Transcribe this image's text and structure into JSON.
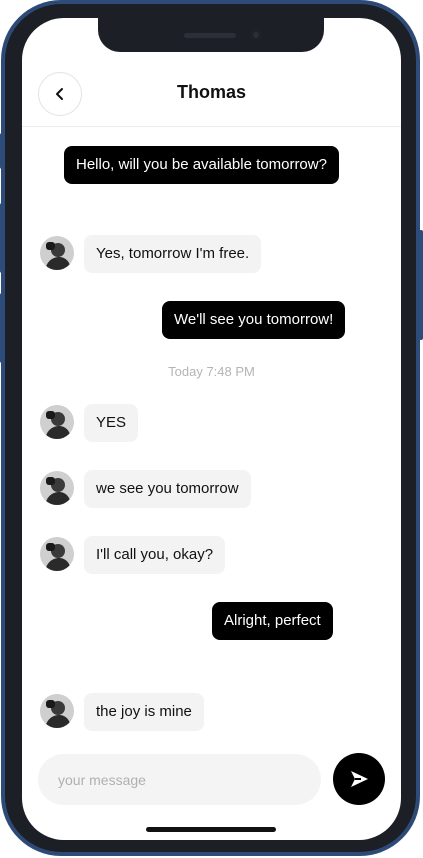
{
  "header": {
    "title": "Thomas"
  },
  "messages": [
    {
      "side": "sent",
      "text": "Hello, will you be available tomorrow?"
    },
    {
      "side": "received",
      "text": "Yes, tomorrow I'm free."
    },
    {
      "side": "sent",
      "text": "We'll see you tomorrow!"
    },
    {
      "side": "received",
      "text": "YES"
    },
    {
      "side": "received",
      "text": "we see you tomorrow"
    },
    {
      "side": "received",
      "text": "I'll call you, okay?"
    },
    {
      "side": "sent",
      "text": "Alright, perfect"
    },
    {
      "side": "received",
      "text": "the joy is mine"
    }
  ],
  "timestamp": "Today 7:48 PM",
  "composer": {
    "placeholder": "your message",
    "value": ""
  },
  "icons": {
    "back": "chevron-left-icon",
    "send": "send-icon",
    "avatar": "avatar"
  },
  "colors": {
    "sent_bubble": "#000000",
    "received_bubble": "#f3f3f3",
    "frame_accent": "#2e4c79"
  }
}
